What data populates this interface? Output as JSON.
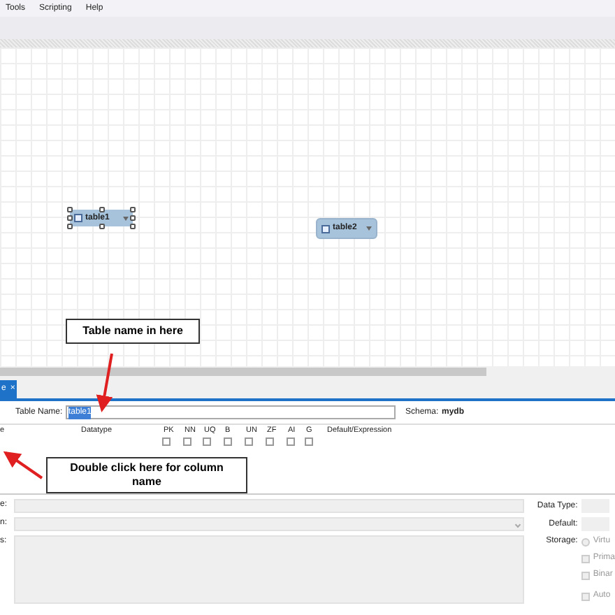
{
  "menu": [
    {
      "label": "Tools"
    },
    {
      "label": "Scripting"
    },
    {
      "label": "Help"
    }
  ],
  "canvas": {
    "tables": [
      {
        "name": "table1",
        "selected": true
      },
      {
        "name": "table2",
        "selected": false
      }
    ]
  },
  "editor_tab": {
    "label": "e",
    "close": "×",
    "selected": true
  },
  "table_name": {
    "label": "Table Name:",
    "value": "table1"
  },
  "schema": {
    "label": "Schema:",
    "value": "mydb"
  },
  "columns": [
    "e",
    "Datatype",
    "PK",
    "NN",
    "UQ",
    "B",
    "UN",
    "ZF",
    "AI",
    "G",
    "Default/Expression"
  ],
  "flags": [
    {
      "checked": false
    },
    {
      "checked": false
    },
    {
      "checked": false
    },
    {
      "checked": false
    },
    {
      "checked": false
    },
    {
      "checked": false
    },
    {
      "checked": false
    },
    {
      "checked": false
    }
  ],
  "details": {
    "fields": [
      {
        "label": "e:",
        "kind": "text"
      },
      {
        "label": "n:",
        "kind": "select"
      },
      {
        "label": "s:",
        "kind": "area"
      }
    ],
    "right": [
      {
        "label": "Data Type:"
      },
      {
        "label": "Default:"
      }
    ],
    "storage": {
      "label": "Storage:",
      "options": [
        {
          "label": "Virtu",
          "kind": "radio",
          "checked": false
        },
        {
          "label": "Prima",
          "kind": "check",
          "checked": false
        },
        {
          "label": "Binar",
          "kind": "check",
          "checked": false
        },
        {
          "label": "Auto",
          "kind": "check",
          "checked": false
        }
      ]
    }
  },
  "annotations": [
    {
      "text": "Table name in here"
    },
    {
      "text": "Double click here for column name"
    }
  ]
}
